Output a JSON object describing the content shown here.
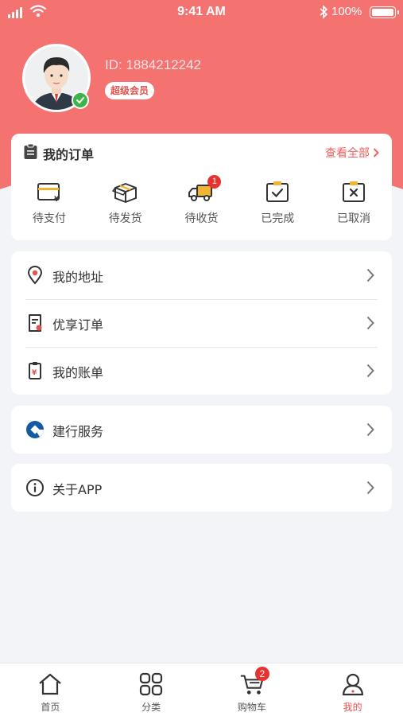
{
  "status_bar": {
    "time": "9:41 AM",
    "battery": "100%"
  },
  "profile": {
    "user_id": "ID: 1884212242",
    "member_level": "超级会员"
  },
  "orders": {
    "title": "我的订单",
    "view_all": "查看全部",
    "items": [
      {
        "label": "待支付",
        "icon": "card-yen-icon"
      },
      {
        "label": "待发货",
        "icon": "box-icon"
      },
      {
        "label": "待收货",
        "icon": "truck-icon",
        "badge": "1"
      },
      {
        "label": "已完成",
        "icon": "done-clipboard-icon"
      },
      {
        "label": "已取消",
        "icon": "cancel-clipboard-icon"
      }
    ]
  },
  "menu": {
    "address": "我的地址",
    "vip_orders": "优享订单",
    "bills": "我的账单",
    "ccb_service": "建行服务",
    "about": "关于APP"
  },
  "tabbar": {
    "items": [
      {
        "label": "首页",
        "icon": "home-icon"
      },
      {
        "label": "分类",
        "icon": "grid-icon"
      },
      {
        "label": "购物车",
        "icon": "cart-icon",
        "badge": "2"
      },
      {
        "label": "我的",
        "icon": "profile-icon",
        "active": true
      }
    ]
  },
  "colors": {
    "brand": "#f47270",
    "accent": "#e5534f",
    "badge": "#e8322f",
    "verified": "#3bb54a"
  }
}
